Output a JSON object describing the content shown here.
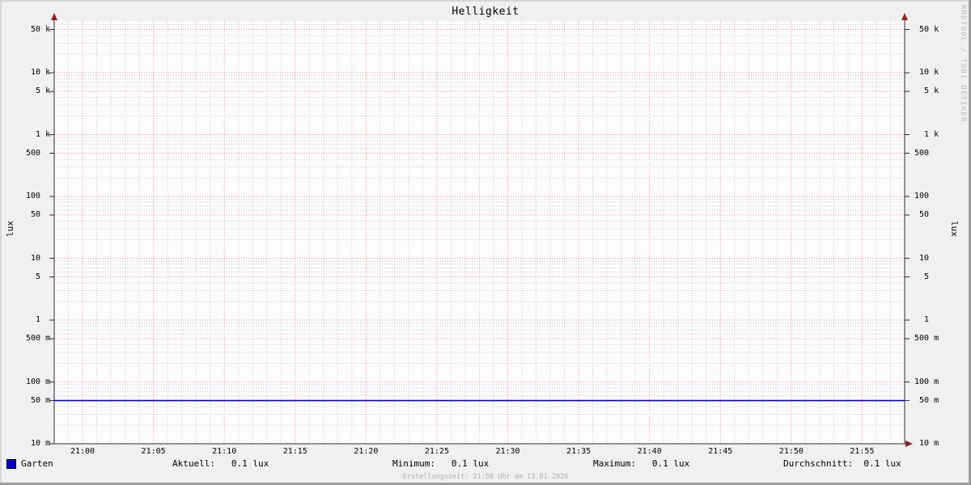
{
  "title": "Helligkeit",
  "watermark": "RRDTOOL / TOBI OETIKER",
  "axis_label_left": "lux",
  "axis_label_right": "lux",
  "footer": {
    "creation_time": "Erstellungszeit: 21:58 Uhr am 13.01.2026"
  },
  "legend": {
    "series": {
      "label": "Garten",
      "swatch_color": "#0000cc"
    },
    "stats": [
      {
        "label": "Aktuell:",
        "value": "0.1 lux",
        "display": "Aktuell:   0.1 lux"
      },
      {
        "label": "Minimum:",
        "value": "0.1 lux",
        "display": "Minimum:   0.1 lux"
      },
      {
        "label": "Maximum:",
        "value": "0.1 lux",
        "display": "Maximum:   0.1 lux"
      },
      {
        "label": "Durchschnitt:",
        "value": "0.1 lux",
        "display": "Durchschnitt:  0.1 lux"
      }
    ]
  },
  "chart_data": {
    "type": "line",
    "title": "Helligkeit",
    "xlabel": "",
    "ylabel": "lux",
    "y_scale": "logarithmic",
    "ylim": [
      0.01,
      100000
    ],
    "x_start_time": "20:58",
    "x_end_time": "21:58",
    "x_minor_grid_minutes": 1,
    "x_major_grid_minutes": 5,
    "x_ticks": [
      {
        "minute": 2,
        "label": "21:00"
      },
      {
        "minute": 7,
        "label": "21:05"
      },
      {
        "minute": 12,
        "label": "21:10"
      },
      {
        "minute": 17,
        "label": "21:15"
      },
      {
        "minute": 22,
        "label": "21:20"
      },
      {
        "minute": 27,
        "label": "21:25"
      },
      {
        "minute": 32,
        "label": "21:30"
      },
      {
        "minute": 37,
        "label": "21:35"
      },
      {
        "minute": 42,
        "label": "21:40"
      },
      {
        "minute": 47,
        "label": "21:45"
      },
      {
        "minute": 52,
        "label": "21:50"
      },
      {
        "minute": 57,
        "label": "21:55"
      }
    ],
    "y_ticks": [
      {
        "value": 50000,
        "label": " 50 k"
      },
      {
        "value": 10000,
        "label": " 10 k"
      },
      {
        "value": 5000,
        "label": "  5 k"
      },
      {
        "value": 1000,
        "label": "  1 k"
      },
      {
        "value": 500,
        "label": "500  "
      },
      {
        "value": 100,
        "label": "100  "
      },
      {
        "value": 50,
        "label": " 50  "
      },
      {
        "value": 10,
        "label": " 10  "
      },
      {
        "value": 5,
        "label": "  5  "
      },
      {
        "value": 1,
        "label": "  1  "
      },
      {
        "value": 0.5,
        "label": "500 m"
      },
      {
        "value": 0.1,
        "label": "100 m"
      },
      {
        "value": 0.05,
        "label": " 50 m"
      },
      {
        "value": 0.01,
        "label": " 10 m"
      }
    ],
    "series": [
      {
        "name": "Garten",
        "color": "#0000cc",
        "shape": "constant-line",
        "y_constant": 0.05
      }
    ],
    "grid": {
      "minor_on": true,
      "major_on": true
    },
    "legend_position": "bottom",
    "colors": {
      "canvas": "#fcfcfc",
      "background": "#f0f0f0",
      "minor_grid": "#c8c8c8",
      "major_grid": "#f08f8f",
      "axis": "#2e2e2e",
      "arrow": "#992020",
      "line": "#0000cc",
      "watermark": "#bdbdbd",
      "footer_text": "#b0b0b0"
    }
  }
}
